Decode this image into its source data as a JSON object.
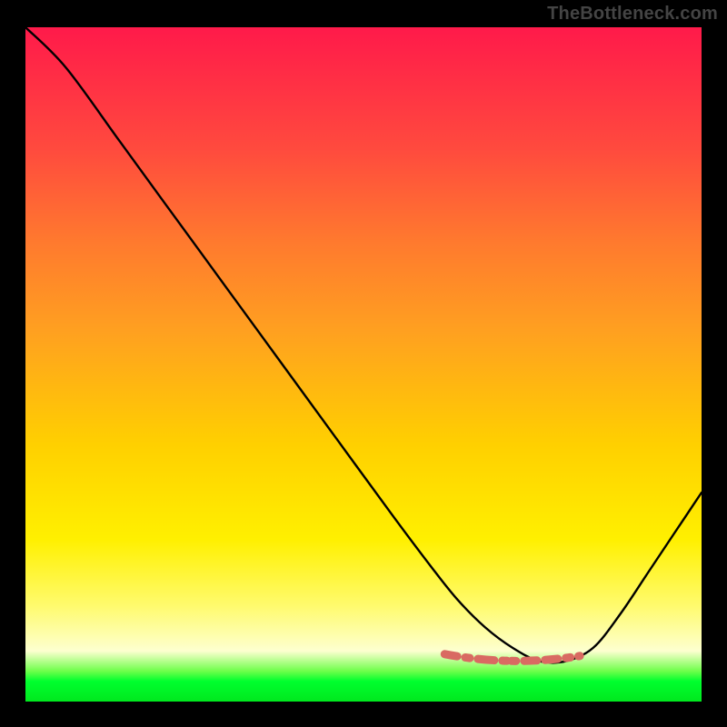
{
  "watermark": "TheBottleneck.com",
  "chart_data": {
    "type": "line",
    "title": "",
    "xlabel": "",
    "ylabel": "",
    "xlim": [
      0,
      1
    ],
    "ylim": [
      0,
      1
    ],
    "series": [
      {
        "name": "curve",
        "x": [
          0.0,
          0.06,
          0.14,
          0.22,
          0.3,
          0.38,
          0.46,
          0.54,
          0.6,
          0.64,
          0.68,
          0.72,
          0.76,
          0.8,
          0.84,
          0.88,
          0.92,
          0.96,
          1.0
        ],
        "y": [
          1.0,
          0.94,
          0.83,
          0.72,
          0.61,
          0.5,
          0.39,
          0.28,
          0.2,
          0.15,
          0.11,
          0.08,
          0.06,
          0.06,
          0.08,
          0.13,
          0.19,
          0.25,
          0.31
        ]
      }
    ],
    "optimal_band": {
      "name": "optimal-range-marker",
      "x": [
        0.62,
        0.82
      ],
      "y": 0.065
    },
    "gradient_stops": [
      {
        "pos": 0.0,
        "color": "#ff1a4a"
      },
      {
        "pos": 0.32,
        "color": "#ff7a2e"
      },
      {
        "pos": 0.62,
        "color": "#ffd000"
      },
      {
        "pos": 0.9,
        "color": "#fdffd0"
      },
      {
        "pos": 0.97,
        "color": "#00ff2e"
      },
      {
        "pos": 1.0,
        "color": "#00e81e"
      }
    ]
  }
}
